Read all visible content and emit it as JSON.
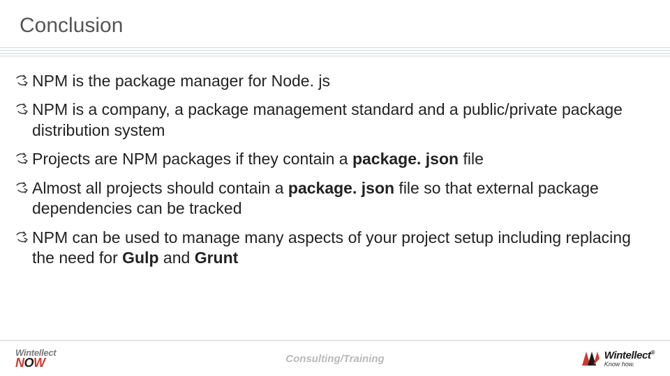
{
  "title": "Conclusion",
  "bullets": [
    {
      "html": "NPM is the package manager for Node. js"
    },
    {
      "html": "NPM is a company, a package management standard and a public/private package distribution system"
    },
    {
      "html": "Projects are NPM packages if they contain a <b>package. json</b> file"
    },
    {
      "html": "Almost all projects should contain a <b>package. json</b> file so that external package dependencies can be tracked"
    },
    {
      "html": "NPM can be used to manage many aspects of your project setup including replacing the need for <b>Gulp</b> and <b>Grunt</b>"
    }
  ],
  "footer": {
    "left_brand_top": "Wintellect",
    "left_brand_bottom": "NOW",
    "center": "Consulting/Training",
    "right_brand": "Wintellect",
    "right_tag": "Know how."
  }
}
